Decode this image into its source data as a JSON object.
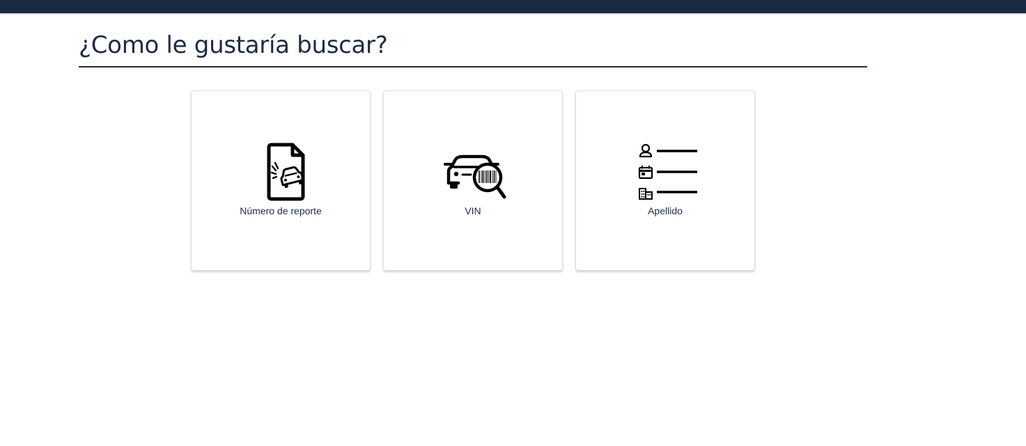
{
  "page": {
    "title": "¿Como le gustaría buscar?"
  },
  "search_options": [
    {
      "label": "Número de reporte",
      "icon": "accident-report-document-icon"
    },
    {
      "label": "VIN",
      "icon": "car-barcode-search-icon"
    },
    {
      "label": "Apellido",
      "icon": "person-details-list-icon"
    }
  ],
  "colors": {
    "header_bar": "#1b2a44",
    "title_text": "#1e2b43",
    "card_border": "#dcdfe4"
  }
}
